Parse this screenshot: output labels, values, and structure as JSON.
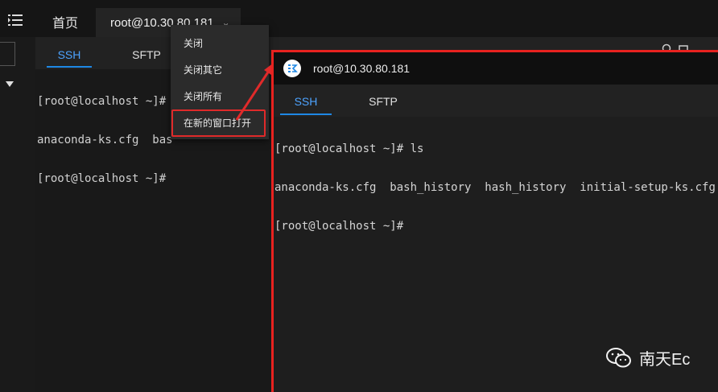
{
  "header": {
    "tabs": [
      {
        "label": "首页"
      },
      {
        "label": "root@10.30.80.181"
      }
    ]
  },
  "subtabs": [
    "SSH",
    "SFTP"
  ],
  "background_terminal": {
    "lines": [
      "[root@localhost ~]#",
      "anaconda-ks.cfg  bas",
      "[root@localhost ~]#"
    ]
  },
  "context_menu": {
    "items": [
      "关闭",
      "关闭其它",
      "关闭所有",
      "在新的窗口打开"
    ]
  },
  "new_window": {
    "title": "root@10.30.80.181",
    "tabs": [
      "SSH",
      "SFTP"
    ],
    "terminal_lines": [
      "[root@localhost ~]# ls",
      "anaconda-ks.cfg  bash_history  hash_history  initial-setup-ks.cfg",
      "[root@localhost ~]#"
    ]
  },
  "watermark": {
    "text": "南天Ec"
  },
  "colors": {
    "accent": "#1e88e5",
    "highlight": "#e02a2a"
  }
}
